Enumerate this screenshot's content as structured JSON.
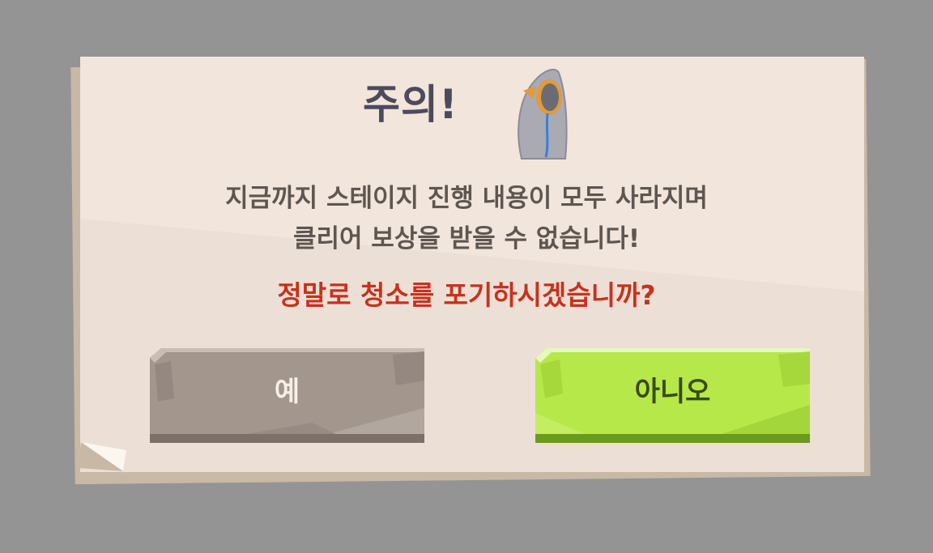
{
  "dialog": {
    "title": "주의!",
    "message_line1": "지금까지 스테이지 진행 내용이 모두 사라지며",
    "message_line2": "클리어 보상을 받을 수 없습니다!",
    "question": "정말로 청소를 포기하시겠습니까?",
    "yes_label": "예",
    "no_label": "아니오"
  },
  "icons": {
    "mascot": "mascot-icon"
  },
  "colors": {
    "background": "#949494",
    "paper": "#f1e5dc",
    "title_text": "#4c4b5b",
    "message_text": "#5e5650",
    "question_text": "#c7321c",
    "yes_button": "#a3978d",
    "no_button": "#b6e84a"
  }
}
